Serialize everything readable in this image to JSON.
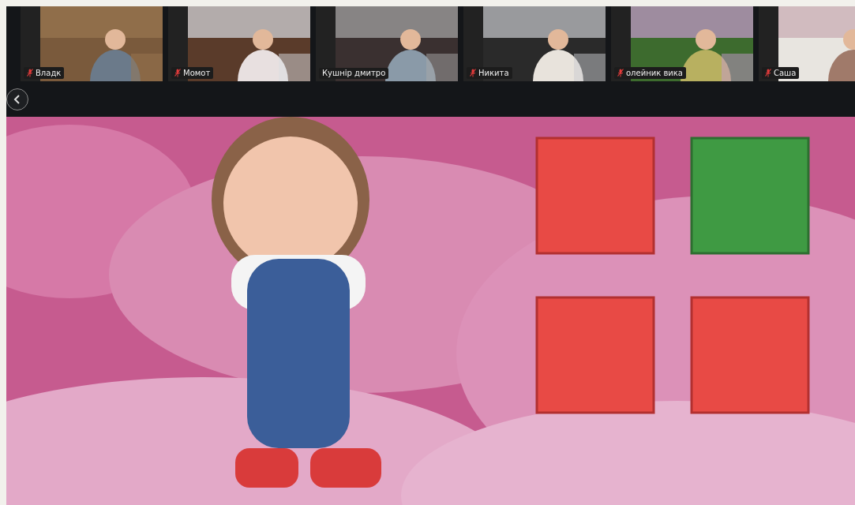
{
  "participants": [
    {
      "name": "Владк",
      "muted": true
    },
    {
      "name": "Момот",
      "muted": true
    },
    {
      "name": "Кушнір дмитро",
      "muted": false
    },
    {
      "name": "Никита",
      "muted": true
    },
    {
      "name": "олейник вика",
      "muted": true
    },
    {
      "name": "Саша",
      "muted": true
    }
  ]
}
